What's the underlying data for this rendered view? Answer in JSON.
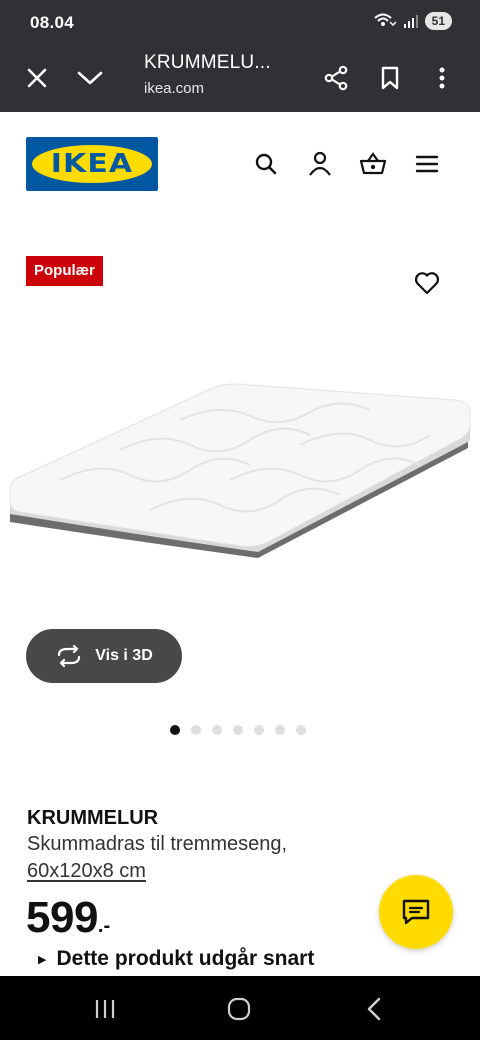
{
  "status_bar": {
    "time": "08.04",
    "battery": "51",
    "icons": [
      "wifi-calling-icon",
      "signal-icon",
      "battery-icon"
    ]
  },
  "browser": {
    "title": "KRUMMELU...",
    "url": "ikea.com",
    "icons": [
      "close-icon",
      "chevron-down-icon",
      "share-icon",
      "bookmark-icon",
      "more-vert-icon"
    ]
  },
  "header": {
    "logo_text": "IKEA",
    "icons": [
      "search-icon",
      "profile-icon",
      "basket-icon",
      "menu-icon"
    ]
  },
  "product": {
    "badge": "Populær",
    "view_3d_label": "Vis i 3D",
    "gallery_count": 7,
    "gallery_active": 0,
    "name": "KRUMMELUR",
    "description": "Skummadras til tremmeseng,",
    "size": "60x120x8 cm",
    "price": "599",
    "price_suffix": ".-",
    "notice": "Dette produkt udgår snart"
  },
  "colors": {
    "ikea_blue": "#0058a3",
    "ikea_yellow": "#ffdb00",
    "badge_red": "#cc0008",
    "bar_dark": "#303134"
  }
}
